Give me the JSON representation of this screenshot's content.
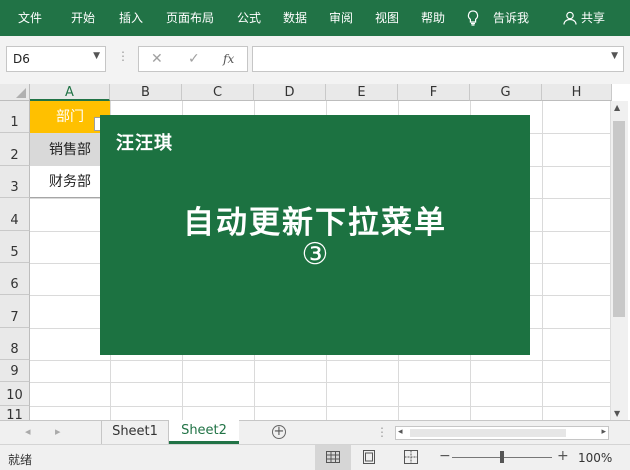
{
  "ribbon": {
    "tabs": [
      "文件",
      "开始",
      "插入",
      "页面布局",
      "公式",
      "数据",
      "审阅",
      "视图",
      "帮助"
    ],
    "tell_me": "告诉我",
    "share": "共享"
  },
  "formula_bar": {
    "name_box": "D6",
    "cancel_glyph": "✕",
    "enter_glyph": "✓",
    "fx_label": "fx",
    "formula_value": ""
  },
  "grid": {
    "columns": [
      "A",
      "B",
      "C",
      "D",
      "E",
      "F",
      "G",
      "H"
    ],
    "rows": [
      "1",
      "2",
      "3",
      "4",
      "5",
      "6",
      "7",
      "8",
      "9",
      "10",
      "11"
    ],
    "cells": {
      "A1": "部门",
      "A2": "销售部",
      "A3": "财务部"
    },
    "header_fill": "#FFC000"
  },
  "banner": {
    "author": "汪汪琪",
    "title": "自动更新下拉菜单",
    "episode": "③",
    "background": "#1C7241"
  },
  "sheet_tabs": {
    "tabs": [
      "Sheet1",
      "Sheet2"
    ],
    "active": "Sheet2"
  },
  "status": {
    "ready": "就绪",
    "zoom": "100%"
  },
  "colors": {
    "ribbon": "#217346",
    "accent_green": "#217346"
  }
}
